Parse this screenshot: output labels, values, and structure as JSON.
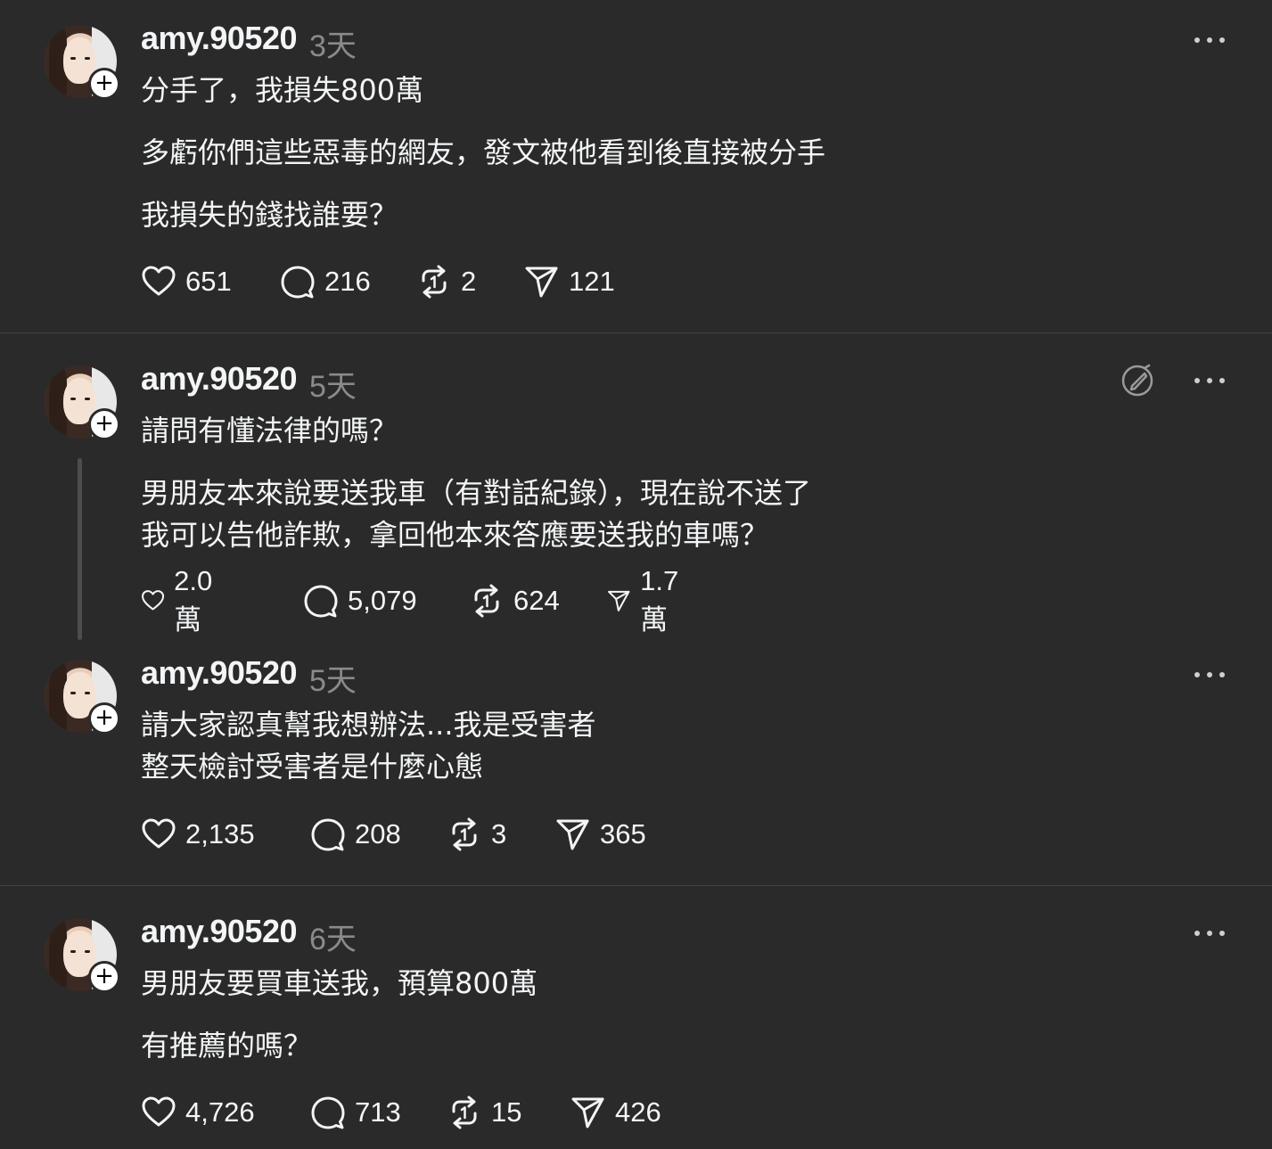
{
  "posts": [
    {
      "username": "amy.90520",
      "time": "3天",
      "lines": [
        "分手了，我損失800萬",
        "多虧你們這些惡毒的網友，發文被他看到後直接被分手",
        "我損失的錢找誰要？"
      ],
      "likes": "651",
      "replies": "216",
      "reposts": "2",
      "shares": "121"
    },
    {
      "username": "amy.90520",
      "time": "5天",
      "lines": [
        "請問有懂法律的嗎？",
        "男朋友本來說要送我車（有對話紀錄），現在說不送了",
        "我可以告他詐欺，拿回他本來答應要送我的車嗎？"
      ],
      "likes": "2.0 萬",
      "replies": "5,079",
      "reposts": "624",
      "shares": "1.7 萬"
    },
    {
      "username": "amy.90520",
      "time": "5天",
      "lines": [
        "請大家認真幫我想辦法...我是受害者",
        "整天檢討受害者是什麼心態"
      ],
      "likes": "2,135",
      "replies": "208",
      "reposts": "3",
      "shares": "365"
    },
    {
      "username": "amy.90520",
      "time": "6天",
      "lines": [
        "男朋友要買車送我，預算800萬",
        "有推薦的嗎？"
      ],
      "likes": "4,726",
      "replies": "713",
      "reposts": "15",
      "shares": "426"
    }
  ],
  "icons": {
    "follow": "+",
    "like": "heart-icon",
    "reply": "comment-icon",
    "repost": "repost-icon",
    "share": "send-icon",
    "more": "more-icon",
    "edit": "edit-icon"
  },
  "colors": {
    "background": "#2a2a2a",
    "text": "#f3f5f7",
    "muted": "#8a8a8a",
    "divider": "#444444"
  }
}
